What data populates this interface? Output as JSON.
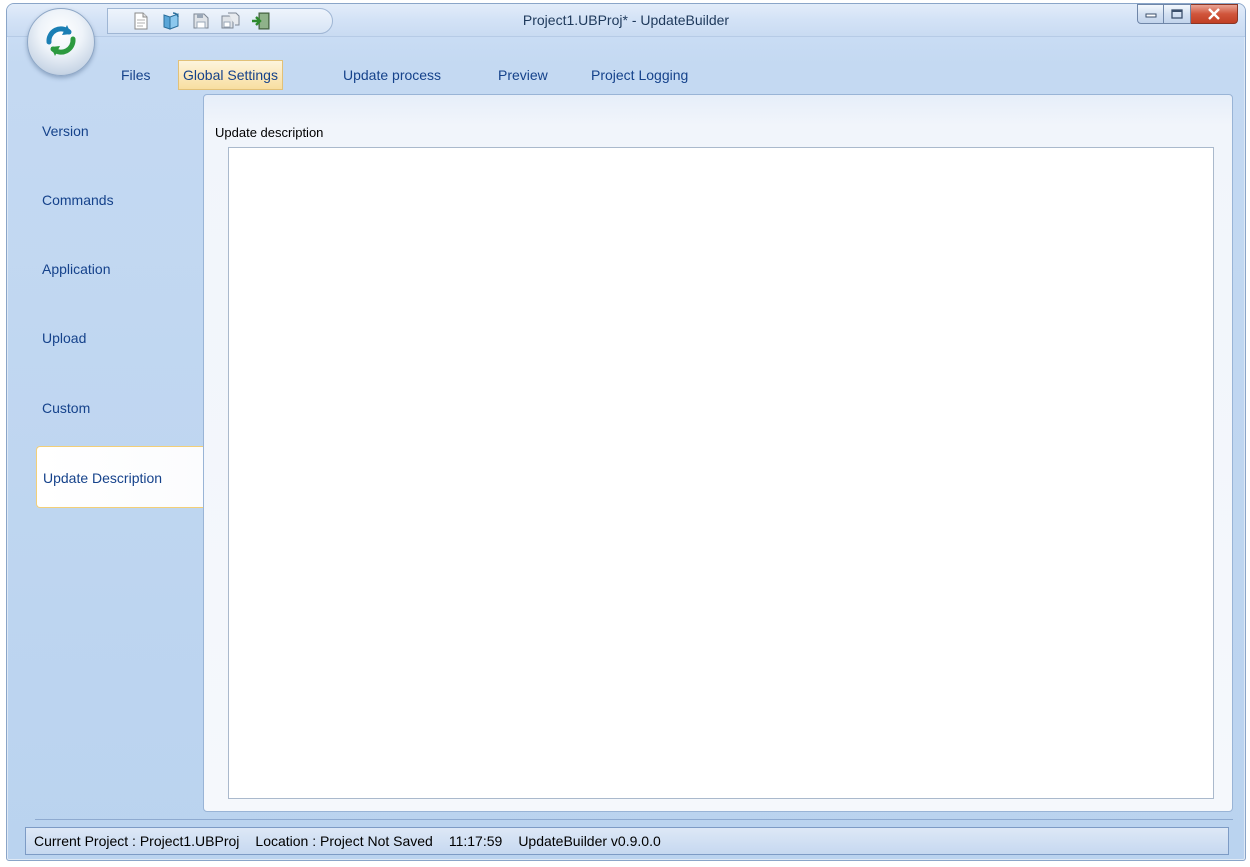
{
  "window": {
    "title": "Project1.UBProj* - UpdateBuilder"
  },
  "app_button": {
    "icon": "refresh-orb-icon"
  },
  "quick_access": [
    {
      "name": "new-file-icon"
    },
    {
      "name": "open-icon"
    },
    {
      "name": "save-icon"
    },
    {
      "name": "save-all-icon"
    },
    {
      "name": "exit-icon"
    }
  ],
  "menu": {
    "files": "Files",
    "global_settings": "Global Settings",
    "update_process": "Update process",
    "preview": "Preview",
    "project_logging": "Project Logging"
  },
  "nav": {
    "items": [
      {
        "label": "Version"
      },
      {
        "label": "Commands"
      },
      {
        "label": "Application"
      },
      {
        "label": "Upload"
      },
      {
        "label": "Custom"
      },
      {
        "label": "Update Description"
      }
    ],
    "active": "Update Description"
  },
  "content": {
    "label": "Update description",
    "value": ""
  },
  "status": {
    "project": "Current Project : Project1.UBProj",
    "location": "Location : Project Not Saved",
    "time": "11:17:59",
    "version": "UpdateBuilder v0.9.0.0"
  },
  "colors": {
    "accent": "#15428b",
    "active_tab": "#f8dea0",
    "window_bg": "#c4d9f2",
    "close_button": "#d0553b"
  }
}
